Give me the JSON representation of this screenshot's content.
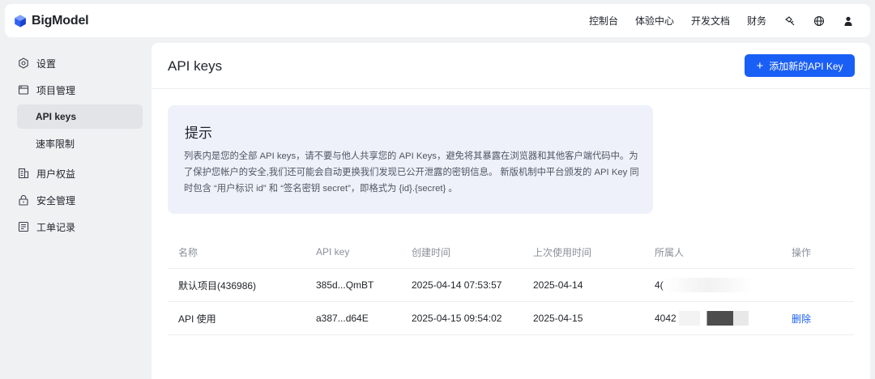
{
  "brand": {
    "name": "BigModel"
  },
  "topnav": {
    "items": [
      "控制台",
      "体验中心",
      "开发文档",
      "财务"
    ],
    "icons": [
      "chat-icon",
      "globe-icon",
      "user-icon"
    ]
  },
  "sidebar": {
    "items": [
      {
        "label": "设置",
        "icon": "settings-icon"
      },
      {
        "label": "项目管理",
        "icon": "project-icon"
      },
      {
        "label": "API keys",
        "sub": true,
        "active": true
      },
      {
        "label": "速率限制",
        "sub": true
      },
      {
        "label": "用户权益",
        "icon": "benefits-icon"
      },
      {
        "label": "安全管理",
        "icon": "lock-icon"
      },
      {
        "label": "工单记录",
        "icon": "ticket-icon"
      }
    ]
  },
  "main": {
    "title": "API keys",
    "add_button": "添加新的API Key",
    "tip": {
      "title": "提示",
      "body": "列表内是您的全部 API keys，请不要与他人共享您的 API Keys，避免将其暴露在浏览器和其他客户端代码中。为了保护您帐户的安全,我们还可能会自动更换我们发现已公开泄露的密钥信息。 新版机制中平台颁发的 API Key 同时包含 “用户标识 id” 和 “签名密钥 secret”，即格式为 {id}.{secret} 。"
    },
    "table": {
      "columns": [
        "名称",
        "API key",
        "创建时间",
        "上次使用时间",
        "所属人",
        "操作"
      ],
      "rows": [
        {
          "name": "默认项目(436986)",
          "key": "385d...QmBT",
          "created": "2025-04-14 07:53:57",
          "last_used": "2025-04-14",
          "owner": "4(",
          "action": ""
        },
        {
          "name": "API 使用",
          "key": "a387...d64E",
          "created": "2025-04-15 09:54:02",
          "last_used": "2025-04-15",
          "owner": "4042",
          "action": "删除"
        }
      ]
    }
  },
  "colors": {
    "accent": "#1a5ff5",
    "tip_bg": "#eef1f9",
    "page_bg": "#f0f1f3"
  }
}
